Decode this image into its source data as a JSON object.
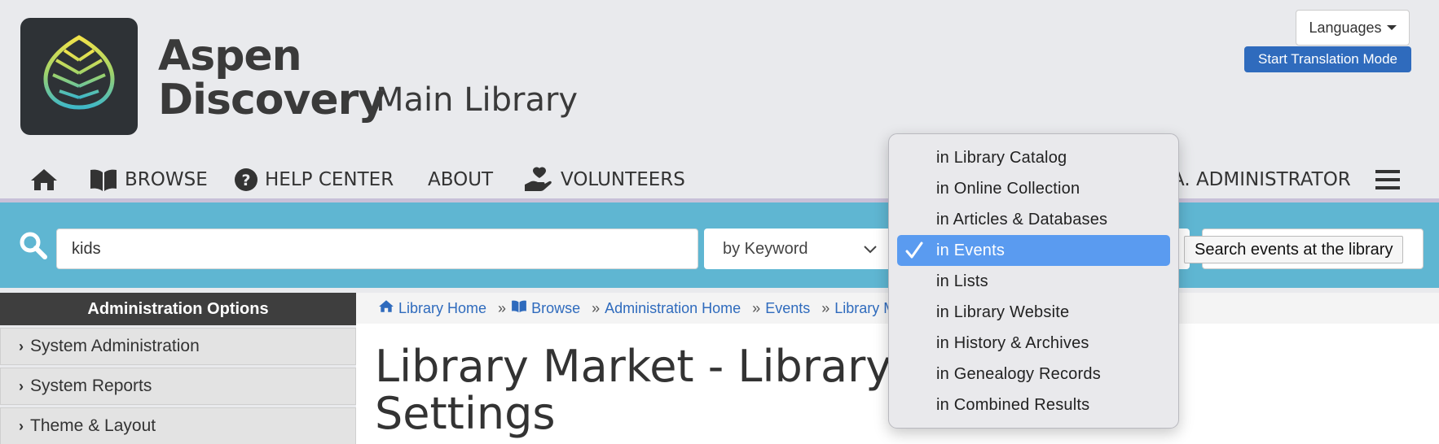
{
  "header": {
    "brand_line1": "Aspen",
    "brand_line2": "Discovery",
    "library_name": "Main Library",
    "languages_label": "Languages",
    "translation_button": "Start Translation Mode",
    "logo_icon": "aspen-leaf-logo"
  },
  "nav": {
    "items": [
      {
        "label": "",
        "icon": "home-icon"
      },
      {
        "label": "Browse",
        "icon": "book-icon"
      },
      {
        "label": "Help Center",
        "icon": "question-circle-icon"
      },
      {
        "label": "About",
        "icon": ""
      },
      {
        "label": "Volunteers",
        "icon": "hand-heart-icon"
      }
    ],
    "user_label": "A. Administrator",
    "menu_icon": "hamburger-icon"
  },
  "search": {
    "query": "kids",
    "by_value": "by Keyword",
    "tooltip": "Search events at the library"
  },
  "scope_menu": {
    "options": [
      "in Library Catalog",
      "in Online Collection",
      "in Articles & Databases",
      "in Events",
      "in Lists",
      "in Library Website",
      "in History & Archives",
      "in Genealogy Records",
      "in Combined Results"
    ],
    "selected_index": 3
  },
  "sidebar": {
    "title": "Administration Options",
    "items": [
      {
        "label": "System Administration"
      },
      {
        "label": "System Reports"
      },
      {
        "label": "Theme & Layout"
      }
    ]
  },
  "breadcrumb": {
    "items": [
      "Library Home",
      "Browse",
      "Administration Home",
      "Events",
      "Library Ma"
    ]
  },
  "page": {
    "title_line1": "Library Market - Library C",
    "title_line2": "Settings"
  },
  "colors": {
    "search_bar": "#5fb6d2",
    "translation_button": "#2f6bbd",
    "link": "#2f6bbd",
    "menu_selected": "#5a9bf0",
    "sidebar_header": "#3e3e3e"
  }
}
